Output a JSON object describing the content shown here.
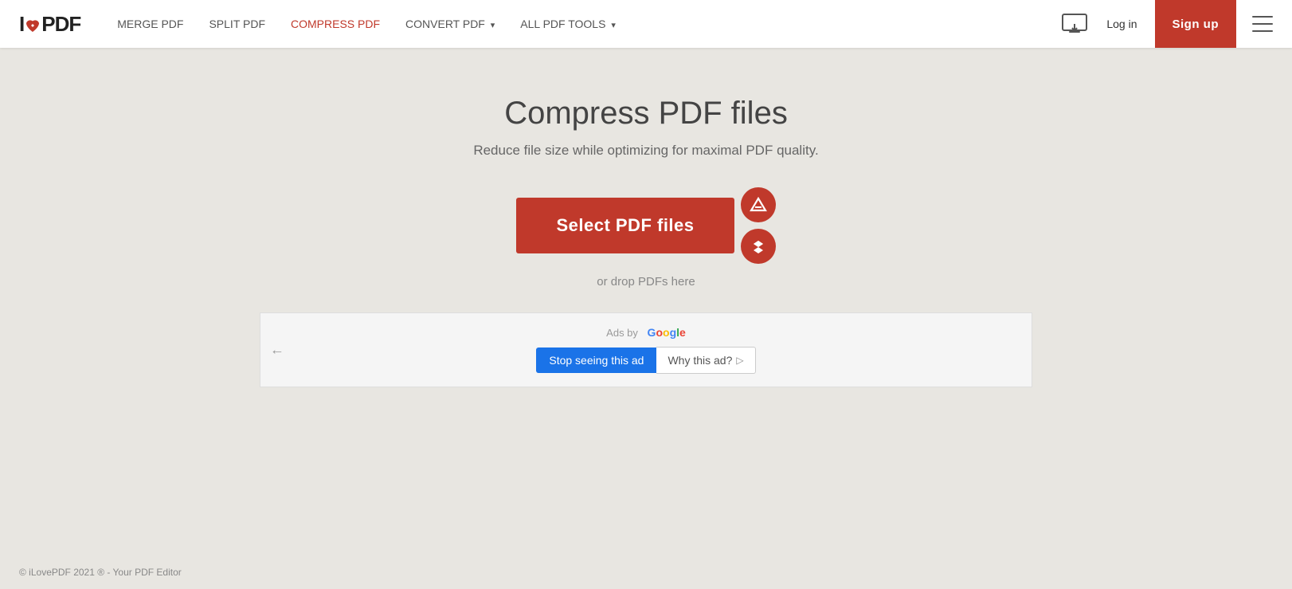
{
  "header": {
    "logo_i": "I",
    "logo_love": "❤",
    "logo_pdf": "PDF",
    "nav": [
      {
        "label": "MERGE PDF",
        "active": false,
        "id": "merge-pdf"
      },
      {
        "label": "SPLIT PDF",
        "active": false,
        "id": "split-pdf"
      },
      {
        "label": "COMPRESS PDF",
        "active": true,
        "id": "compress-pdf"
      },
      {
        "label": "CONVERT PDF",
        "active": false,
        "has_caret": true,
        "id": "convert-pdf"
      },
      {
        "label": "ALL PDF TOOLS",
        "active": false,
        "has_caret": true,
        "id": "all-tools"
      }
    ],
    "login_label": "Log in",
    "signup_label": "Sign up",
    "desktop_icon_title": "Download Desktop App"
  },
  "main": {
    "title": "Compress PDF files",
    "subtitle": "Reduce file size while optimizing for maximal PDF quality.",
    "select_button_label": "Select PDF files",
    "drop_text": "or drop PDFs here",
    "google_drive_title": "Upload from Google Drive",
    "dropbox_title": "Upload from Dropbox"
  },
  "ads": {
    "ads_by_label": "Ads by",
    "google_label": "Google",
    "stop_ad_label": "Stop seeing this ad",
    "why_label": "Why this ad?",
    "back_arrow": "←"
  },
  "footer": {
    "copyright": "© iLovePDF 2021 ® - Your PDF Editor"
  },
  "colors": {
    "brand_red": "#c0392b",
    "nav_active": "#c0392b",
    "google_blue": "#1a73e8",
    "bg": "#e8e6e1"
  }
}
